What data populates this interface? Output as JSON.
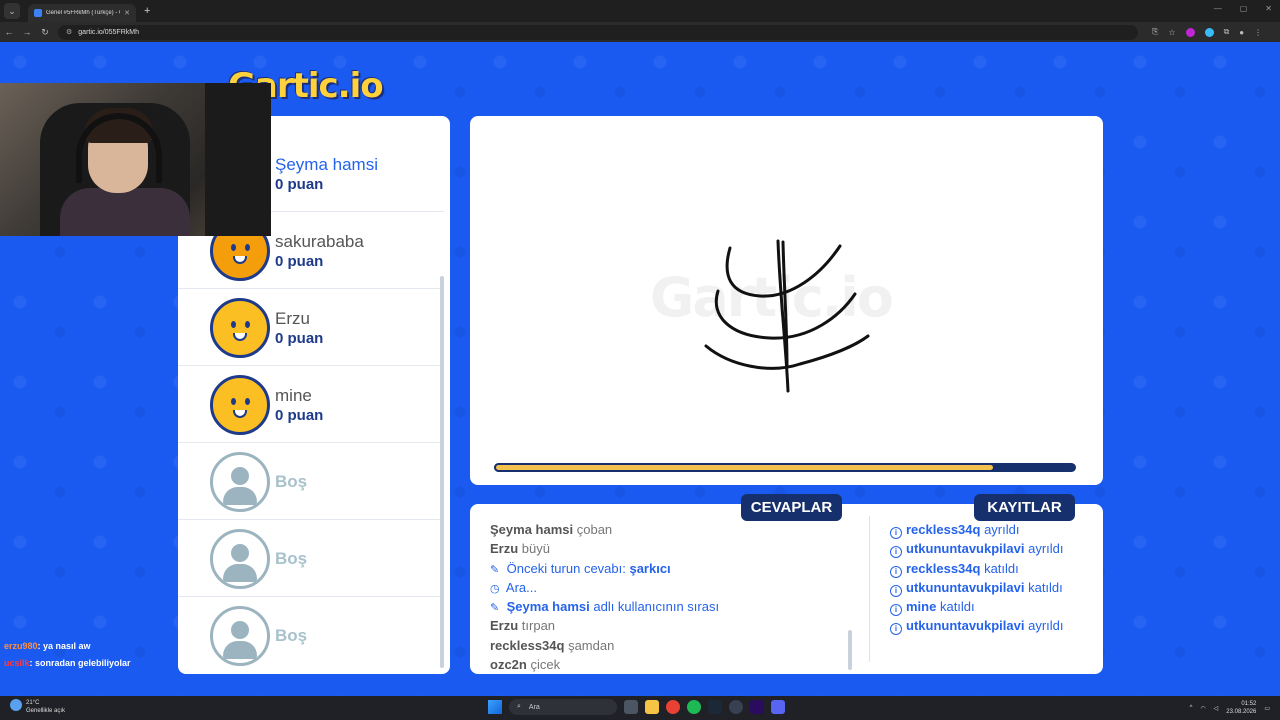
{
  "browser": {
    "tab_title": "Genel #5FRkMh (Türkçe) - Gartic",
    "url": "gartic.io/055FRkMh",
    "new_tab": "+",
    "close": "✕"
  },
  "logo": "Gartic.io",
  "players": [
    {
      "name": "Şeyma hamsi",
      "score": "0 puan",
      "active": true
    },
    {
      "name": "sakurababa",
      "score": "0 puan"
    },
    {
      "name": "Erzu",
      "score": "0 puan"
    },
    {
      "name": "mine",
      "score": "0 puan"
    },
    {
      "name": "Boş"
    },
    {
      "name": "Boş"
    },
    {
      "name": "Boş"
    }
  ],
  "canvas": {
    "watermark": "Gartic.io",
    "timer_fraction": 0.86
  },
  "tabs": {
    "answers": "CEVAPLAR",
    "logs": "KAYITLAR"
  },
  "answers": [
    {
      "user": "Şeyma hamsi",
      "text": "çoban"
    },
    {
      "user": "Erzu",
      "text": "büyü"
    },
    {
      "icon": "pencil-icon",
      "text": "Önceki turun cevabı: ",
      "bold": "şarkıcı",
      "system": true
    },
    {
      "icon": "clock-icon",
      "text": "Ara...",
      "system": true
    },
    {
      "icon": "pencil-icon",
      "user": "Şeyma hamsi",
      "text": "adlı kullanıcının sırası",
      "system": true
    },
    {
      "user": "Erzu",
      "text": "tırpan"
    },
    {
      "user": "reckless34q",
      "text": "şamdan"
    },
    {
      "user": "ozc2n",
      "text": "çicek"
    }
  ],
  "logs": [
    {
      "user": "reckless34q",
      "text": "ayrıldı"
    },
    {
      "user": "utkununtavukpilavi",
      "text": "ayrıldı"
    },
    {
      "user": "reckless34q",
      "text": "katıldı"
    },
    {
      "user": "utkununtavukpilavi",
      "text": "katıldı"
    },
    {
      "user": "mine",
      "text": "katıldı"
    },
    {
      "user": "utkununtavukpilavi",
      "text": "ayrıldı"
    }
  ],
  "stream_chat": [
    {
      "user": "erzu980",
      "text": ": ya nasıl aw"
    },
    {
      "user": "ucsilk",
      "text": ": sonradan gelebiliyolar"
    }
  ],
  "taskbar": {
    "weather_temp": "21°C",
    "weather_desc": "Genellikle açık",
    "search": "Ara",
    "time": "01:52",
    "date": "23.08.2026"
  }
}
